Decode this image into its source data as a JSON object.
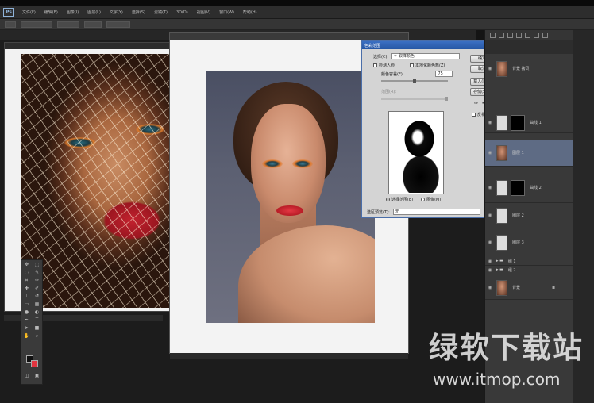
{
  "app": {
    "logo": "Ps",
    "menu_items": [
      "文件(F)",
      "编辑(E)",
      "图像(I)",
      "图层(L)",
      "文字(Y)",
      "选择(S)",
      "滤镜(T)",
      "3D(D)",
      "视图(V)",
      "窗口(W)",
      "帮助(H)"
    ]
  },
  "dialog": {
    "title": "色彩范围",
    "select_label": "选择(C):",
    "select_value": "取样颜色",
    "detect_faces": "检测人脸",
    "localized": "本地化颜色簇(Z)",
    "fuzziness_label": "颜色容差(F):",
    "fuzziness_value": "75",
    "range_label": "范围(R):",
    "ok": "确定",
    "cancel": "取消",
    "load": "载入(L)...",
    "save": "存储(S)...",
    "invert": "反相(I)",
    "radio_selection": "选择范围(E)",
    "radio_image": "图像(M)",
    "preview_label": "选区预览(T):",
    "preview_value": "无"
  },
  "layers": {
    "items": [
      {
        "name": "背景 拷贝"
      },
      {
        "name": "曲线 1"
      },
      {
        "name": "图层 1"
      },
      {
        "name": "曲线 2"
      },
      {
        "name": "图层 2"
      },
      {
        "name": "图层 3"
      },
      {
        "name": "组 1"
      },
      {
        "name": "组 2"
      },
      {
        "name": "背景"
      }
    ]
  },
  "watermark": {
    "brand": "绿软下载站",
    "url": "www.itmop.com"
  },
  "colors": {
    "accent": "#3b6fc2",
    "fg_swatch": "#111111",
    "bg_swatch": "#e23540"
  }
}
